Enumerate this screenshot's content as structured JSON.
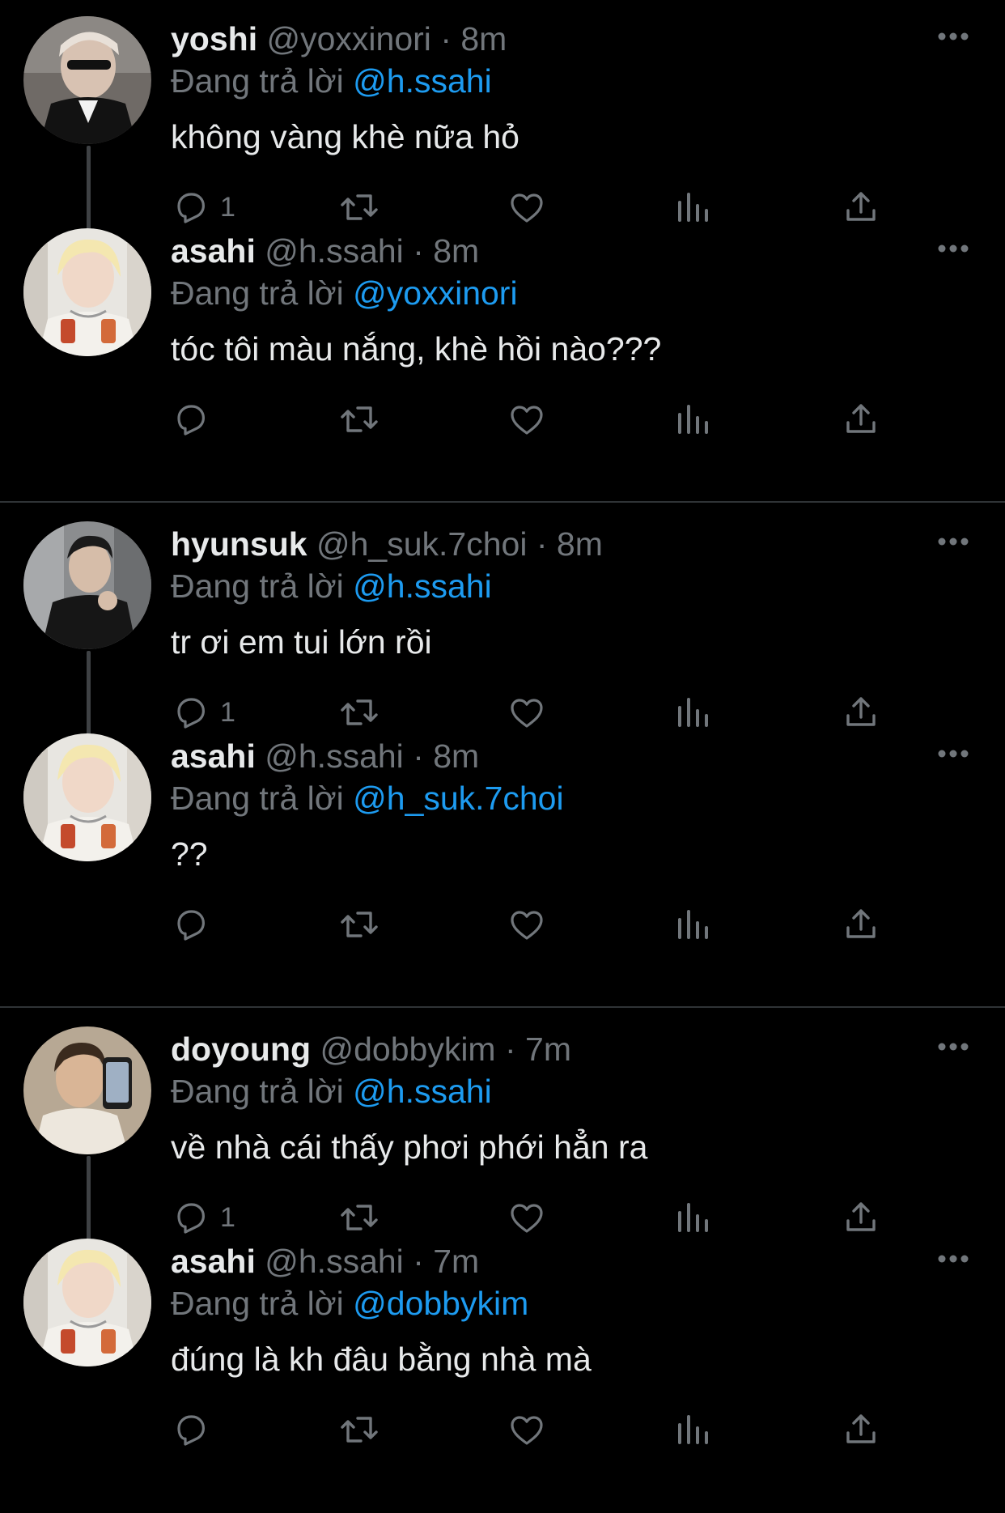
{
  "colors": {
    "background": "#000000",
    "text": "#e7e9ea",
    "muted": "#71767b",
    "link": "#1d9bf0",
    "divider": "#2f3336",
    "thread_line": "#3e4144"
  },
  "reply_prefix": "Đang trả lời",
  "tweets": [
    {
      "name": "yoshi",
      "handle": "@yoxxinori",
      "time": "8m",
      "reply_to": "@h.ssahi",
      "text": "không vàng khè nữa hỏ",
      "reply_count": "1",
      "avatar_icon": "avatar-yoshi"
    },
    {
      "name": "asahi",
      "handle": "@h.ssahi",
      "time": "8m",
      "reply_to": "@yoxxinori",
      "text": "tóc tôi màu nắng, khè hồi nào???",
      "reply_count": "",
      "avatar_icon": "avatar-asahi"
    },
    {
      "name": "hyunsuk",
      "handle": "@h_suk.7choi",
      "time": "8m",
      "reply_to": "@h.ssahi",
      "text": "tr ơi em tui lớn rồi",
      "reply_count": "1",
      "avatar_icon": "avatar-hyunsuk"
    },
    {
      "name": "asahi",
      "handle": "@h.ssahi",
      "time": "8m",
      "reply_to": "@h_suk.7choi",
      "text": "??",
      "reply_count": "",
      "avatar_icon": "avatar-asahi"
    },
    {
      "name": "doyoung",
      "handle": "@dobbykim",
      "time": "7m",
      "reply_to": "@h.ssahi",
      "text": "về nhà cái thấy phơi phới hẳn ra",
      "reply_count": "1",
      "avatar_icon": "avatar-doyoung"
    },
    {
      "name": "asahi",
      "handle": "@h.ssahi",
      "time": "7m",
      "reply_to": "@dobbykim",
      "text": "đúng là kh đâu bằng nhà mà",
      "reply_count": "",
      "avatar_icon": "avatar-asahi"
    }
  ]
}
